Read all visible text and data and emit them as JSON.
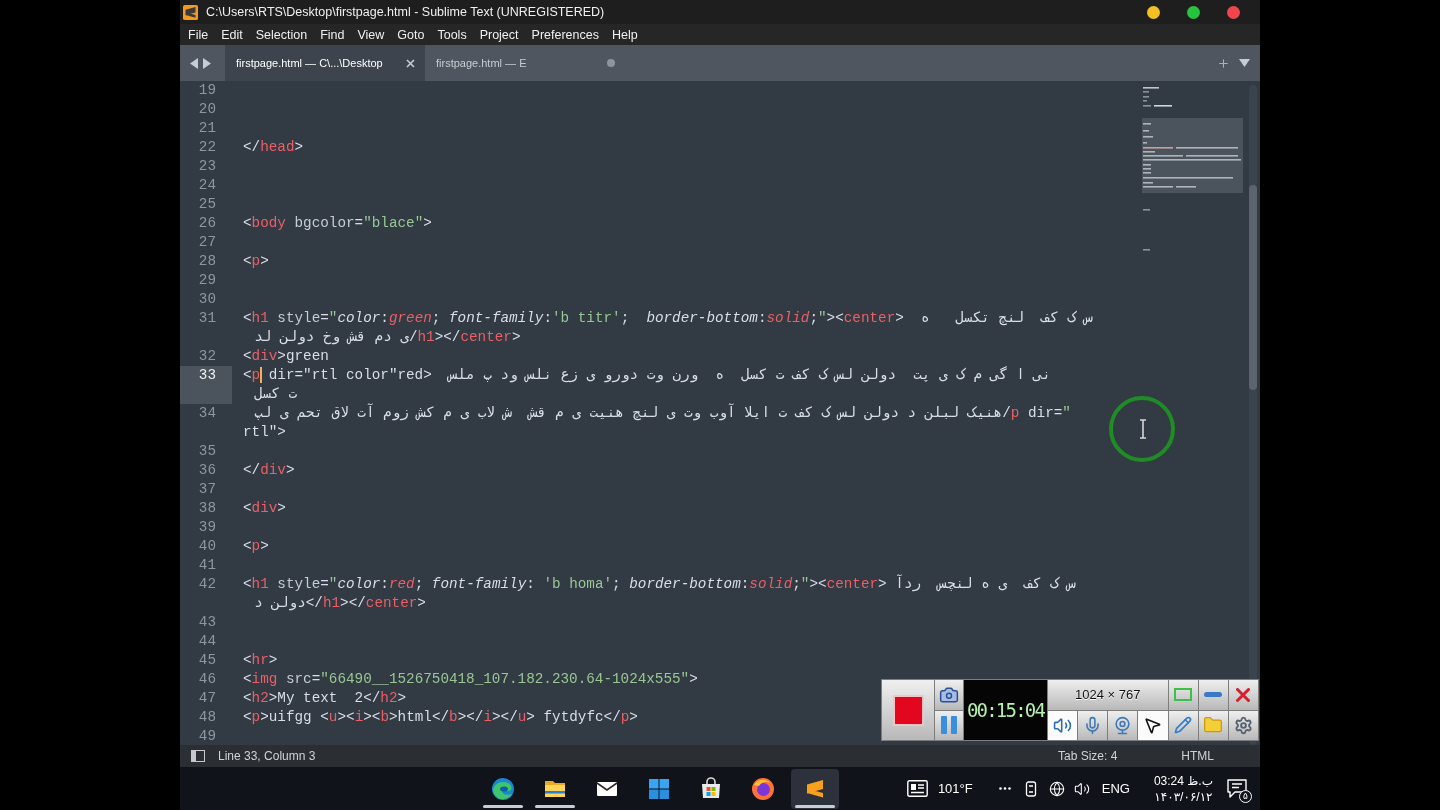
{
  "window": {
    "title": "C:\\Users\\RTS\\Desktop\\firstpage.html - Sublime Text (UNREGISTERED)",
    "controls": [
      {
        "color": "#f5c021"
      },
      {
        "color": "#27c43f"
      },
      {
        "color": "#f0454a"
      }
    ]
  },
  "menu": [
    "File",
    "Edit",
    "Selection",
    "Find",
    "View",
    "Goto",
    "Tools",
    "Project",
    "Preferences",
    "Help"
  ],
  "tabs": [
    {
      "label": "firstpage.html — C\\...\\Desktop",
      "selected": true,
      "modified": false
    },
    {
      "label": "firstpage.html — E",
      "selected": false,
      "modified": true
    }
  ],
  "editor": {
    "lines": [
      {
        "number": "19",
        "current": false
      },
      {
        "number": "20",
        "current": false
      },
      {
        "number": "21",
        "current": false
      },
      {
        "number": "22",
        "current": false,
        "wraps": [
          {
            "indented": false,
            "tokens": [
              {
                "kind": "tag",
                "text": "</head>"
              }
            ]
          }
        ]
      },
      {
        "number": "23",
        "current": false
      },
      {
        "number": "24",
        "current": false
      },
      {
        "number": "25",
        "current": false
      },
      {
        "number": "26",
        "current": false,
        "wraps": [
          {
            "indented": false,
            "tokens": [
              {
                "kind": "tag",
                "text": "<body"
              },
              {
                "kind": "attr",
                "text": " bgcolor"
              },
              {
                "kind": "punct",
                "text": "="
              },
              {
                "kind": "string",
                "text": "\"blace\""
              },
              {
                "kind": "tag",
                "text": ">"
              }
            ]
          }
        ]
      },
      {
        "number": "27",
        "current": false
      },
      {
        "number": "28",
        "current": false,
        "wraps": [
          {
            "indented": false,
            "tokens": [
              {
                "kind": "tag",
                "text": "<p>"
              }
            ]
          }
        ]
      },
      {
        "number": "29",
        "current": false
      },
      {
        "number": "30",
        "current": false
      },
      {
        "number": "31",
        "current": false,
        "wraps": [
          {
            "indented": false,
            "tokens": [
              {
                "kind": "tag",
                "text": "<h1"
              },
              {
                "kind": "attr",
                "text": " style"
              },
              {
                "kind": "punct",
                "text": "="
              },
              {
                "kind": "string",
                "text": "\""
              },
              {
                "kind": "prop",
                "text": "color"
              },
              {
                "kind": "punct",
                "text": ":"
              },
              {
                "kind": "value",
                "text": "green"
              },
              {
                "kind": "punct",
                "text": "; "
              },
              {
                "kind": "prop",
                "text": "font-family"
              },
              {
                "kind": "punct",
                "text": ":"
              },
              {
                "kind": "string",
                "text": "'b titr'"
              },
              {
                "kind": "punct",
                "text": ";  "
              },
              {
                "kind": "prop",
                "text": "border-bottom"
              },
              {
                "kind": "punct",
                "text": ":"
              },
              {
                "kind": "value",
                "text": "solid"
              },
              {
                "kind": "punct",
                "text": ";"
              },
              {
                "kind": "string",
                "text": "\""
              },
              {
                "kind": "tag",
                "text": "><center>  "
              },
              {
                "kind": "rtl",
                "text": "س ک کف  لنچ تکسل   ه"
              }
            ]
          },
          {
            "indented": true,
            "tokens": [
              {
                "kind": "rtl",
                "text": "ی دم قش وخ دولن لد"
              },
              {
                "kind": "tag",
                "text": "/h1></center>"
              }
            ]
          }
        ]
      },
      {
        "number": "32",
        "current": false,
        "wraps": [
          {
            "indented": false,
            "tokens": [
              {
                "kind": "tag",
                "text": "<div>"
              },
              {
                "kind": "text",
                "text": "green"
              }
            ]
          }
        ]
      },
      {
        "number": "33",
        "current": true,
        "wraps": [
          {
            "indented": false,
            "tokens": [
              {
                "kind": "tag",
                "text": "<p"
              },
              {
                "kind": "caret"
              },
              {
                "kind": "text",
                "text": " dir=\"rtl color\"red>  "
              },
              {
                "kind": "rtl",
                "text": "نی ا گی م ک ی پت  دولن لس ک کف ت کسل  ه  ورن وت دورو ی زع نلس ود پ ملس"
              }
            ]
          },
          {
            "indented": true,
            "tokens": [
              {
                "kind": "rtl",
                "text": "ت کسل"
              }
            ]
          }
        ]
      },
      {
        "number": "34",
        "current": false,
        "wraps": [
          {
            "indented": true,
            "tokens": [
              {
                "kind": "rtl",
                "text": "هنیک لبلن د دولن لس ک کف ت ایلا آوب وت ی لنچ هنیت ی م قش  ش لاب ی م کش زوم آت لاق تحم ی لپ"
              },
              {
                "kind": "tag",
                "text": "/p"
              },
              {
                "kind": "text",
                "text": " dir="
              },
              {
                "kind": "string",
                "text": "\""
              }
            ]
          },
          {
            "indented": false,
            "tokens": [
              {
                "kind": "text",
                "text": "rtl\""
              },
              {
                "kind": "tag",
                "text": ">"
              }
            ]
          }
        ]
      },
      {
        "number": "35",
        "current": false
      },
      {
        "number": "36",
        "current": false,
        "wraps": [
          {
            "indented": false,
            "tokens": [
              {
                "kind": "tag",
                "text": "</div>"
              }
            ]
          }
        ]
      },
      {
        "number": "37",
        "current": false
      },
      {
        "number": "38",
        "current": false,
        "wraps": [
          {
            "indented": false,
            "tokens": [
              {
                "kind": "tag",
                "text": "<div>"
              }
            ]
          }
        ]
      },
      {
        "number": "39",
        "current": false
      },
      {
        "number": "40",
        "current": false,
        "wraps": [
          {
            "indented": false,
            "tokens": [
              {
                "kind": "tag",
                "text": "<p>"
              }
            ]
          }
        ]
      },
      {
        "number": "41",
        "current": false
      },
      {
        "number": "42",
        "current": false,
        "wraps": [
          {
            "indented": false,
            "tokens": [
              {
                "kind": "tag",
                "text": "<h1"
              },
              {
                "kind": "attr",
                "text": " style"
              },
              {
                "kind": "punct",
                "text": "="
              },
              {
                "kind": "string",
                "text": "\""
              },
              {
                "kind": "prop",
                "text": "color"
              },
              {
                "kind": "punct",
                "text": ":"
              },
              {
                "kind": "value",
                "text": "red"
              },
              {
                "kind": "punct",
                "text": "; "
              },
              {
                "kind": "prop",
                "text": "font-family"
              },
              {
                "kind": "punct",
                "text": ": "
              },
              {
                "kind": "string",
                "text": "'b homa'"
              },
              {
                "kind": "punct",
                "text": "; "
              },
              {
                "kind": "prop",
                "text": "border-bottom"
              },
              {
                "kind": "punct",
                "text": ":"
              },
              {
                "kind": "value",
                "text": "solid"
              },
              {
                "kind": "punct",
                "text": ";"
              },
              {
                "kind": "string",
                "text": "\""
              },
              {
                "kind": "tag",
                "text": "><center> "
              },
              {
                "kind": "rtl",
                "text": "س ک کف  ی ه لنچس  ردآ"
              }
            ]
          },
          {
            "indented": true,
            "tokens": [
              {
                "kind": "rtl",
                "text": "دولن د"
              },
              {
                "kind": "tag",
                "text": "</h1></center>"
              }
            ]
          }
        ]
      },
      {
        "number": "43",
        "current": false
      },
      {
        "number": "44",
        "current": false
      },
      {
        "number": "45",
        "current": false,
        "wraps": [
          {
            "indented": false,
            "tokens": [
              {
                "kind": "tag",
                "text": "<hr>"
              }
            ]
          }
        ]
      },
      {
        "number": "46",
        "current": false,
        "wraps": [
          {
            "indented": false,
            "tokens": [
              {
                "kind": "tag",
                "text": "<img"
              },
              {
                "kind": "attr",
                "text": " src"
              },
              {
                "kind": "punct",
                "text": "="
              },
              {
                "kind": "string",
                "text": "\"66490__1526750418_107.182.230.64-1024x555\""
              },
              {
                "kind": "tag",
                "text": ">"
              }
            ]
          }
        ]
      },
      {
        "number": "47",
        "current": false,
        "wraps": [
          {
            "indented": false,
            "tokens": [
              {
                "kind": "tag",
                "text": "<h2>"
              },
              {
                "kind": "text",
                "text": "My text  2"
              },
              {
                "kind": "tag",
                "text": "</h2>"
              }
            ]
          }
        ]
      },
      {
        "number": "48",
        "current": false,
        "wraps": [
          {
            "indented": false,
            "tokens": [
              {
                "kind": "tag",
                "text": "<p>"
              },
              {
                "kind": "text",
                "text": "uifgg "
              },
              {
                "kind": "tag",
                "text": "<u><i><b>"
              },
              {
                "kind": "text",
                "text": "html"
              },
              {
                "kind": "tag",
                "text": "</b></i></u>"
              },
              {
                "kind": "text",
                "text": " fytdyfc"
              },
              {
                "kind": "tag",
                "text": "</p>"
              }
            ]
          }
        ]
      },
      {
        "number": "49",
        "current": false
      }
    ]
  },
  "status_bar": {
    "position": "Line 33, Column 3",
    "tab_size": "Tab Size: 4",
    "syntax": "HTML"
  },
  "recorder": {
    "timer": "00:15:04",
    "resolution": "1024 × 767",
    "toggles": [
      {
        "kind": "speaker",
        "on": true
      },
      {
        "kind": "microphone",
        "on": false
      },
      {
        "kind": "webcam",
        "on": false
      },
      {
        "kind": "cursor",
        "on": true
      }
    ]
  },
  "taskbar": {
    "apps": [
      {
        "kind": "web",
        "open": true,
        "selected": false
      },
      {
        "kind": "files",
        "open": true,
        "selected": false
      },
      {
        "kind": "mail",
        "open": false,
        "selected": false
      },
      {
        "kind": "start",
        "open": false,
        "selected": false
      },
      {
        "kind": "store",
        "open": false,
        "selected": false
      },
      {
        "kind": "fox",
        "open": false,
        "selected": false
      },
      {
        "kind": "editor",
        "open": true,
        "selected": true
      }
    ],
    "weather": "101°F",
    "language": "ENG",
    "time": "ب.ظ 03:24",
    "date": "۱۴۰۳/۰۶/۱۲",
    "notifications": "۵"
  }
}
